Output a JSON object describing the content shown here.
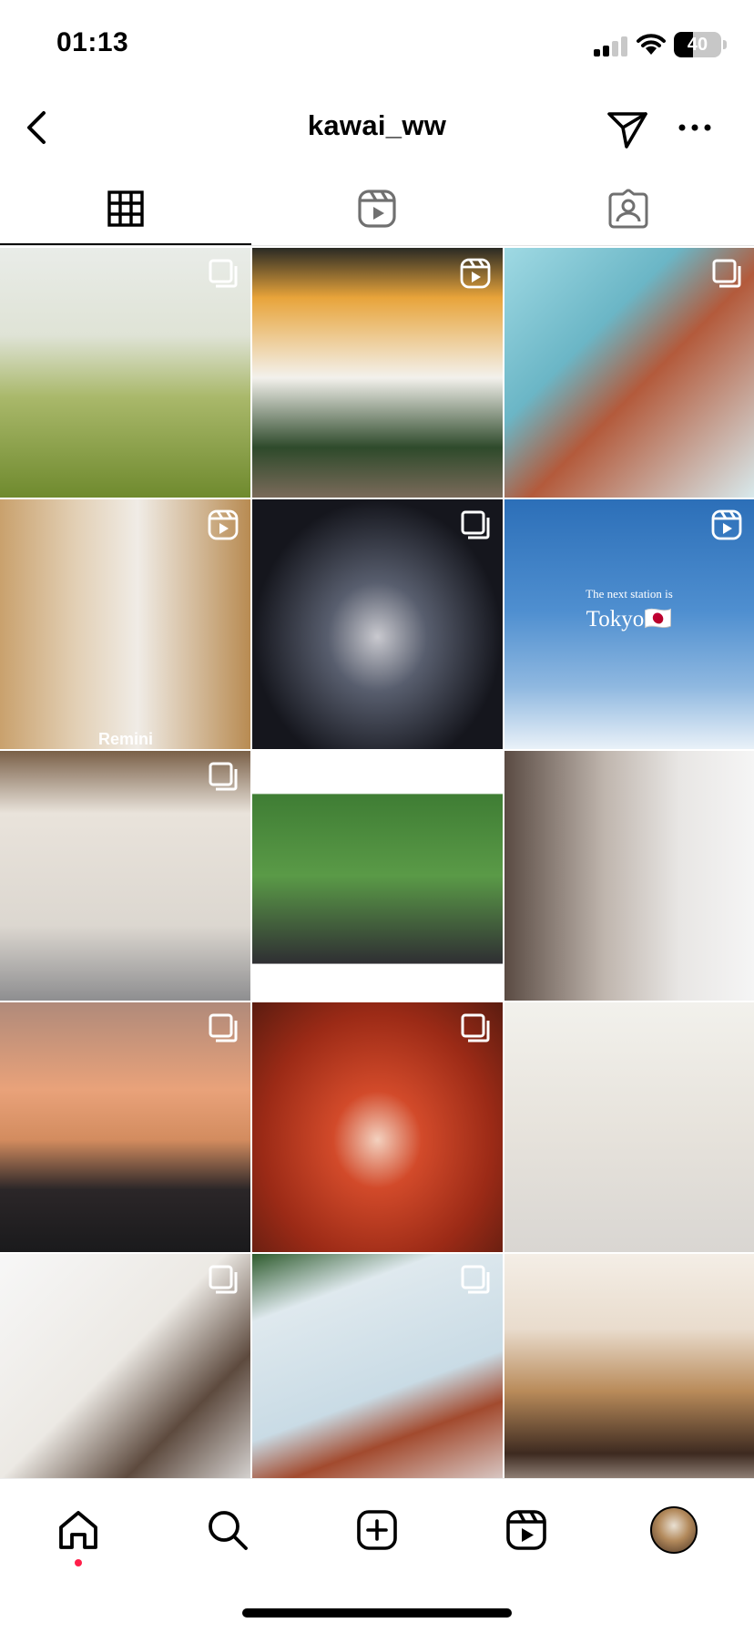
{
  "status_bar": {
    "time": "01:13",
    "battery_level": "40",
    "battery_fraction": 0.4,
    "signal_bars": 2
  },
  "header": {
    "username": "kawai_ww",
    "icons": {
      "back": "chevron-left-icon",
      "send": "paper-plane-icon",
      "more": "more-horizontal-icon"
    }
  },
  "tabs": [
    {
      "name": "posts",
      "icon": "grid-icon",
      "selected": true
    },
    {
      "name": "reels",
      "icon": "reels-icon",
      "selected": false
    },
    {
      "name": "tagged",
      "icon": "tagged-person-icon",
      "selected": false
    }
  ],
  "grid": {
    "tiles": [
      {
        "badge": "multi-post-icon"
      },
      {
        "badge": "reels-icon"
      },
      {
        "badge": "multi-post-icon"
      },
      {
        "badge": "reels-icon",
        "watermark": "Remini"
      },
      {
        "badge": "multi-post-icon"
      },
      {
        "badge": "reels-icon",
        "caption_small": "The next station is",
        "caption_large": "Tokyo🇯🇵"
      },
      {
        "badge": "multi-post-icon"
      },
      {
        "badge": "multi-post-icon"
      },
      {
        "badge": "none"
      },
      {
        "badge": "multi-post-icon"
      },
      {
        "badge": "multi-post-icon"
      },
      {
        "badge": "none"
      },
      {
        "badge": "multi-post-icon"
      },
      {
        "badge": "multi-post-icon"
      },
      {
        "badge": "none"
      }
    ]
  },
  "bottom_nav": {
    "items": [
      {
        "name": "home",
        "icon": "home-icon",
        "has_notification_dot": true
      },
      {
        "name": "search",
        "icon": "search-icon"
      },
      {
        "name": "create",
        "icon": "add-square-icon"
      },
      {
        "name": "reels",
        "icon": "reels-icon"
      },
      {
        "name": "profile",
        "icon": "profile-avatar"
      }
    ],
    "notification_dot_color": "#ff1f4a"
  }
}
